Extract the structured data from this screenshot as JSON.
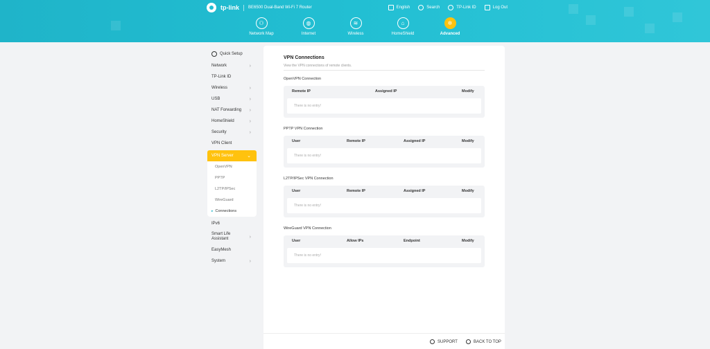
{
  "header": {
    "brand": "tp-link",
    "model": "BE6500 Dual-Band Wi-Fi 7 Router",
    "links": [
      {
        "label": "English",
        "icon": "language-icon"
      },
      {
        "label": "Search",
        "icon": "search-icon"
      },
      {
        "label": "TP-Link ID",
        "icon": "account-icon"
      },
      {
        "label": "Log Out",
        "icon": "logout-icon"
      }
    ],
    "nav": [
      {
        "label": "Network Map",
        "icon": "network-map-icon",
        "glyph": "⚇"
      },
      {
        "label": "Internet",
        "icon": "globe-icon",
        "glyph": "◍"
      },
      {
        "label": "Wireless",
        "icon": "wifi-icon",
        "glyph": "≋"
      },
      {
        "label": "HomeShield",
        "icon": "homeshield-icon",
        "glyph": "⌂"
      },
      {
        "label": "Advanced",
        "icon": "gear-icon",
        "glyph": "✲"
      }
    ]
  },
  "sidebar": {
    "quick_setup": "Quick Setup",
    "items_top": [
      "Network",
      "TP-Link ID",
      "Wireless",
      "USB",
      "NAT Forwarding",
      "HomeShield",
      "Security",
      "VPN Client"
    ],
    "active": "VPN Server",
    "sub": [
      "OpenVPN",
      "PPTP",
      "L2TP/IPSec",
      "WireGuard",
      "Connections"
    ],
    "items_bottom_1": "IPv6",
    "items_bottom_2": "Smart Life Assistant",
    "items_bottom_3": "EasyMesh",
    "items_bottom_4": "System"
  },
  "main": {
    "title": "VPN Connections",
    "description": "View the VPN connections of remote clients.",
    "empty_text": "There is no entry!",
    "sections": [
      {
        "title": "OpenVPN Connection",
        "columns": [
          "Remote IP",
          "Assigned IP",
          "Modify"
        ]
      },
      {
        "title": "PPTP VPN Connection",
        "columns": [
          "User",
          "Remote IP",
          "Assigned IP",
          "Modify"
        ]
      },
      {
        "title": "L2TP/IPSec VPN Connection",
        "columns": [
          "User",
          "Remote IP",
          "Assigned IP",
          "Modify"
        ]
      },
      {
        "title": "WireGuard VPN Connection",
        "columns": [
          "User",
          "Allow IPs",
          "Endpoint",
          "Modify"
        ]
      }
    ]
  },
  "footer": {
    "support": "SUPPORT",
    "back_to_top": "BACK TO TOP"
  },
  "colors": {
    "header": "#22bfd3",
    "accent": "#ffc20e",
    "background": "#f2f3f5"
  }
}
